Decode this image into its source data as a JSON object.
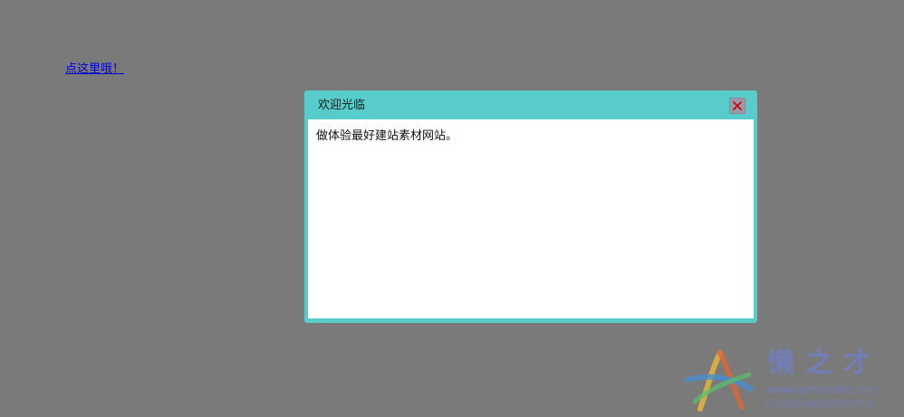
{
  "page": {
    "link_text": "点这里哦！"
  },
  "dialog": {
    "title": "欢迎光临",
    "message": "做体验最好建站素材网站。",
    "close_icon": "close-icon"
  },
  "watermark": {
    "name": "懒之才",
    "url": "www.aizhanzhe.com",
    "slogan": "打造专业建站资源共享平台"
  },
  "colors": {
    "background": "#7a7a7a",
    "dialog_frame": "#58cbcb",
    "close_x": "#cc0000",
    "link": "#0000cc"
  }
}
